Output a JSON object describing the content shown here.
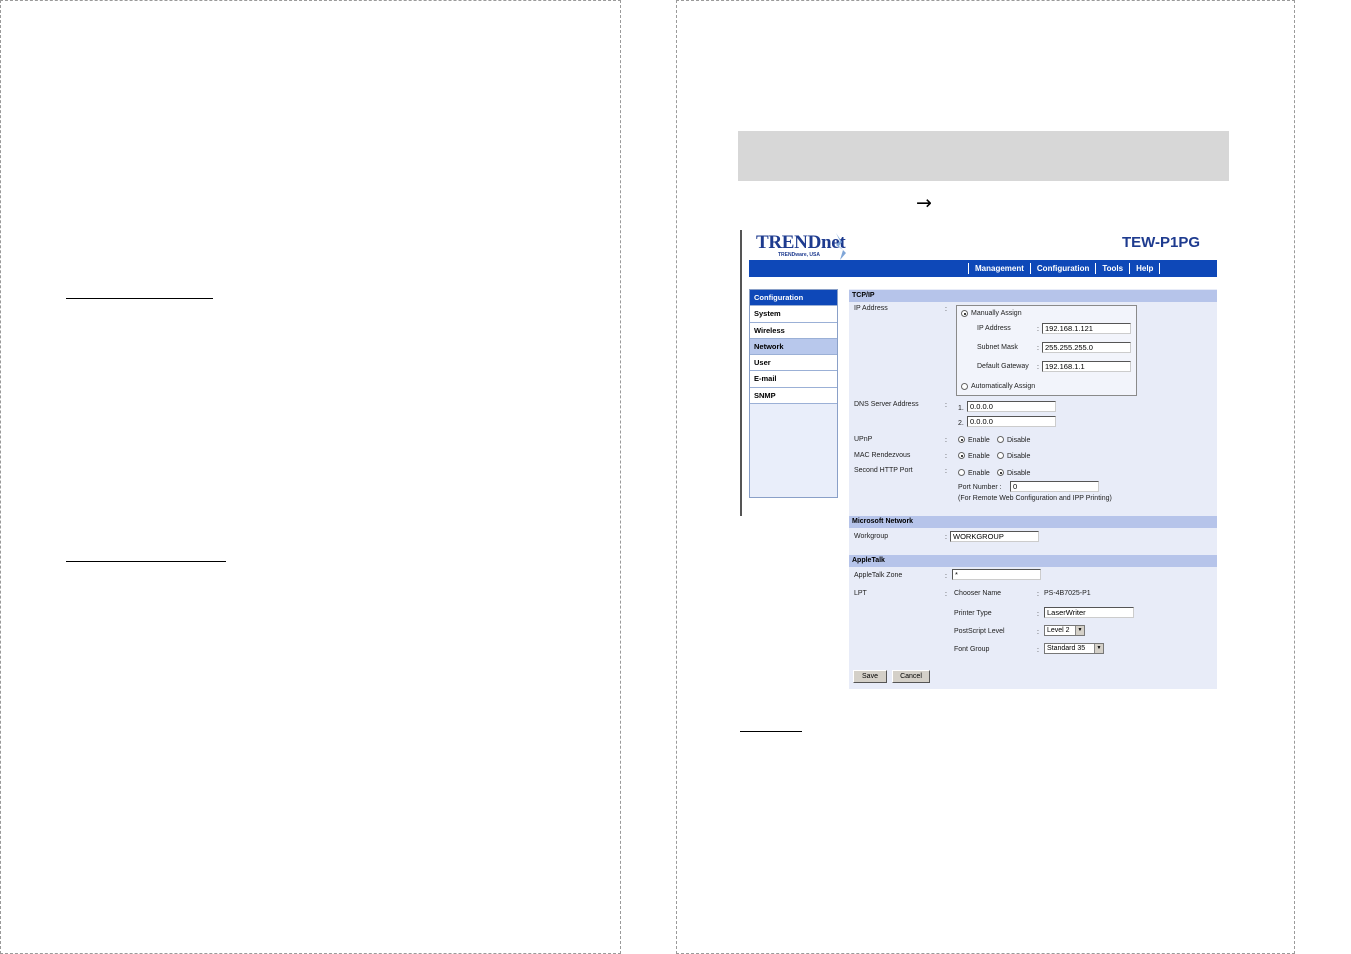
{
  "arrow_glyph": "→",
  "app": {
    "logo_text": "TRENDnet",
    "logo_subtext": "TRENDware, USA",
    "model": "TEW-P1PG"
  },
  "top_menu": [
    "Management",
    "Configuration",
    "Tools",
    "Help"
  ],
  "sidebar": {
    "header": "Configuration",
    "items": [
      "System",
      "Wireless",
      "Network",
      "User",
      "E-mail",
      "SNMP"
    ],
    "active": "Network"
  },
  "tcpip": {
    "section_title": "TCP/IP",
    "ip_address_label": "IP Address",
    "manual_assign_label": "Manually Assign",
    "ip_label": "IP Address",
    "ip_value": "192.168.1.121",
    "subnet_label": "Subnet Mask",
    "subnet_value": "255.255.255.0",
    "gateway_label": "Default Gateway",
    "gateway_value": "192.168.1.1",
    "auto_assign_label": "Automatically Assign",
    "dns_label": "DNS Server Address",
    "dns1_prefix": "1.",
    "dns1_value": "0.0.0.0",
    "dns2_prefix": "2.",
    "dns2_value": "0.0.0.0",
    "upnp_label": "UPnP",
    "mac_rendezvous_label": "MAC Rendezvous",
    "second_http_label": "Second HTTP Port",
    "enable_label": "Enable",
    "disable_label": "Disable",
    "port_number_label": "Port Number :",
    "port_number_value": "0",
    "port_note": "(For Remote Web Configuration and IPP Printing)"
  },
  "microsoft_network": {
    "section_title": "Microsoft Network",
    "workgroup_label": "Workgroup",
    "workgroup_value": "WORKGROUP"
  },
  "appletalk": {
    "section_title": "AppleTalk",
    "zone_label": "AppleTalk Zone",
    "zone_value": "*",
    "lpt_label": "LPT",
    "chooser_label": "Chooser Name",
    "chooser_value": "PS-4B7025-P1",
    "printer_type_label": "Printer Type",
    "printer_type_value": "LaserWriter",
    "postscript_label": "PostScript Level",
    "postscript_value": "Level 2",
    "font_group_label": "Font Group",
    "font_group_value": "Standard 35"
  },
  "buttons": {
    "save": "Save",
    "cancel": "Cancel"
  },
  "colon": ":"
}
